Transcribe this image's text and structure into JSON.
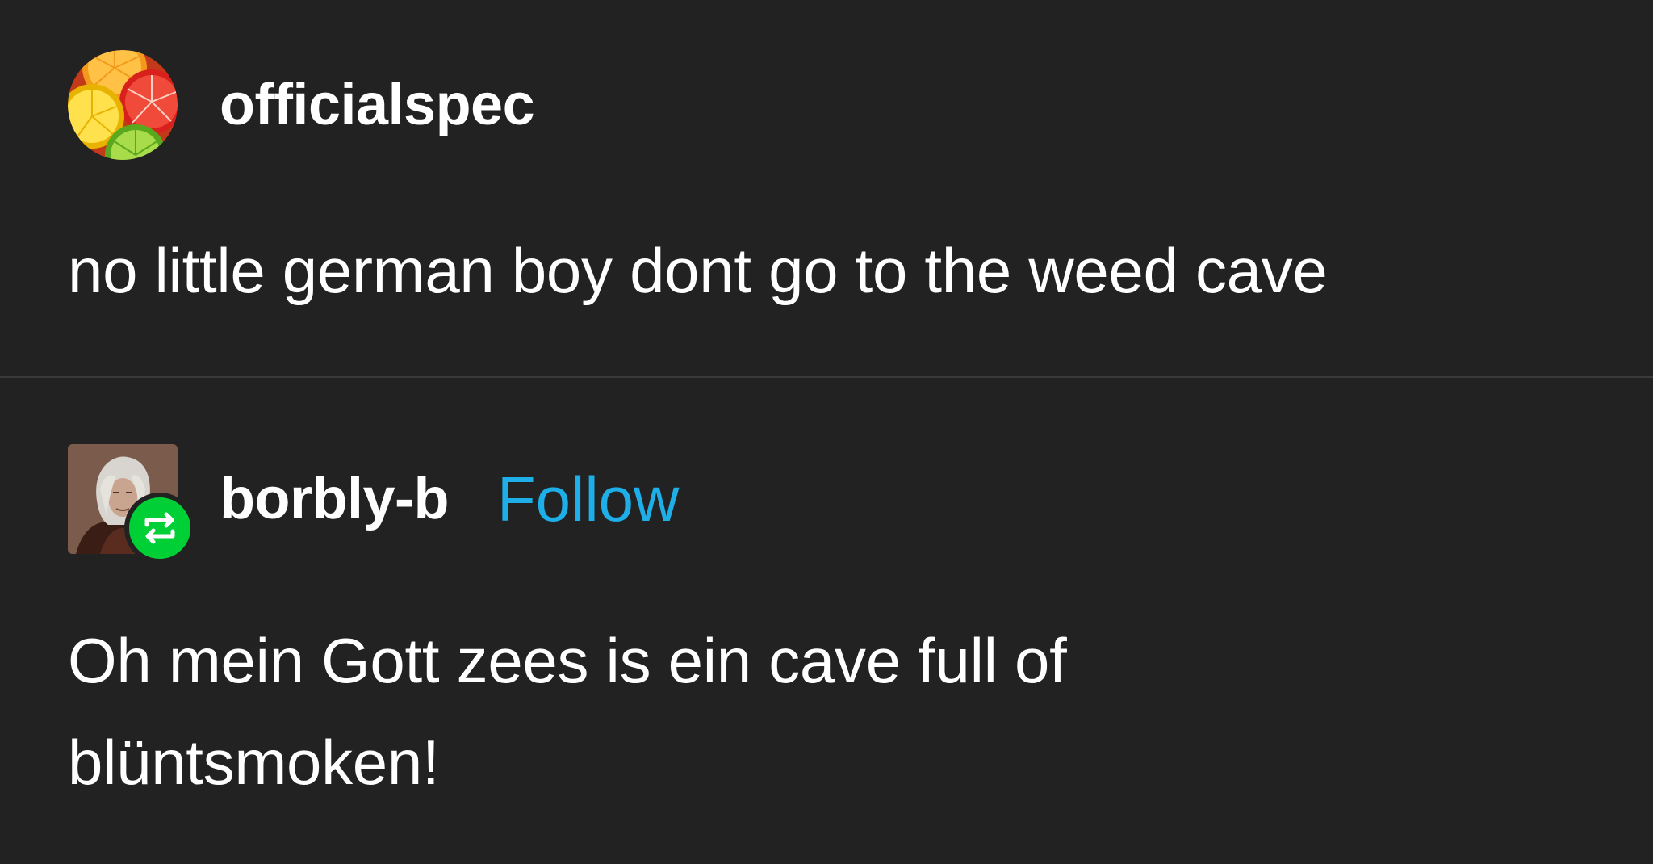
{
  "posts": [
    {
      "username": "officialspec",
      "avatar_icon": "citrus-slices-avatar",
      "body": "no little german boy dont go to the weed cave",
      "follow_label": ""
    },
    {
      "username": "borbly-b",
      "avatar_icon": "portrait-avatar",
      "reblog_icon": "reblog-icon",
      "follow_label": "Follow",
      "body": "Oh mein Gott zees is ein cave full of blüntsmoken!"
    }
  ],
  "colors": {
    "background": "#222222",
    "text": "#ffffff",
    "follow": "#1eaee8",
    "reblog_badge": "#00cf35",
    "divider": "#3a3a3a"
  }
}
